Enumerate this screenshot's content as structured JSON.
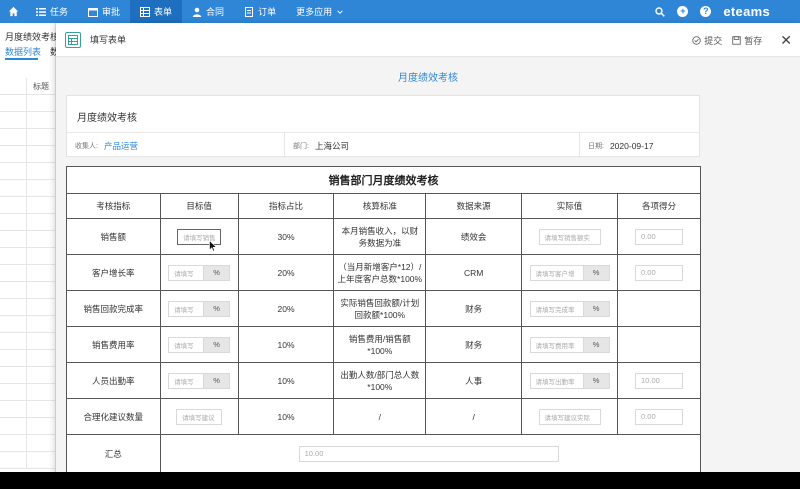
{
  "topnav": {
    "items": [
      {
        "label": "任务",
        "icon": "list-icon"
      },
      {
        "label": "审批",
        "icon": "calendar-icon"
      },
      {
        "label": "表单",
        "icon": "table-icon"
      },
      {
        "label": "合同",
        "icon": "user-icon"
      },
      {
        "label": "订单",
        "icon": "doc-icon"
      },
      {
        "label": "更多应用"
      }
    ],
    "brand": "eteams",
    "help": "?"
  },
  "leftpane": {
    "title": "月度绩效考核",
    "tab_active": "数据列表",
    "tab_other": "数",
    "column_header": "标题"
  },
  "panel": {
    "title": "填写表单",
    "submit_label": "提交",
    "save_label": "暂存",
    "close": "✕"
  },
  "form": {
    "heading": "月度绩效考核",
    "section_title": "月度绩效考核",
    "collector_label": "收集人:",
    "collector_value": "产品运营",
    "dept_label": "部门:",
    "dept_value": "上海公司",
    "date_label": "日期:",
    "date_value": "2020-09-17"
  },
  "table": {
    "caption": "销售部门月度绩效考核",
    "headers": [
      "考核指标",
      "目标值",
      "指标占比",
      "核算标准",
      "数据来源",
      "实际值",
      "各项得分"
    ],
    "rows": [
      {
        "metric": "销售额",
        "target_ph": "请填写销售",
        "ratio": "30%",
        "standard": "本月销售收入，以财务数据为准",
        "source": "绩效会",
        "actual_ph": "请填写销售额实",
        "score": "0.00"
      },
      {
        "metric": "客户增长率",
        "target_ph": "请填写",
        "target_suffix": "%",
        "ratio": "20%",
        "standard": "（当月新增客户*12）/上年度客户总数*100%",
        "source": "CRM",
        "actual_ph": "请填写客户增",
        "actual_suffix": "%",
        "score": "0.00"
      },
      {
        "metric": "销售回款完成率",
        "target_ph": "请填写",
        "target_suffix": "%",
        "ratio": "20%",
        "standard": "实际销售回款额/计划回款额*100%",
        "source": "财务",
        "actual_ph": "请填写完成率",
        "actual_suffix": "%",
        "score": ""
      },
      {
        "metric": "销售费用率",
        "target_ph": "请填写",
        "target_suffix": "%",
        "ratio": "10%",
        "standard": "销售费用/销售额*100%",
        "source": "财务",
        "actual_ph": "请填写费用率",
        "actual_suffix": "%",
        "score": ""
      },
      {
        "metric": "人员出勤率",
        "target_ph": "请填写",
        "target_suffix": "%",
        "ratio": "10%",
        "standard": "出勤人数/部门总人数*100%",
        "source": "人事",
        "actual_ph": "请填写出勤率",
        "actual_suffix": "%",
        "score": "10.00"
      },
      {
        "metric": "合理化建议数量",
        "target_ph": "请填写建议",
        "ratio": "10%",
        "standard": "/",
        "source": "/",
        "actual_ph": "请填写建议实际",
        "score": "0.00"
      }
    ],
    "summary_label": "汇总",
    "summary_value": "10.00"
  }
}
